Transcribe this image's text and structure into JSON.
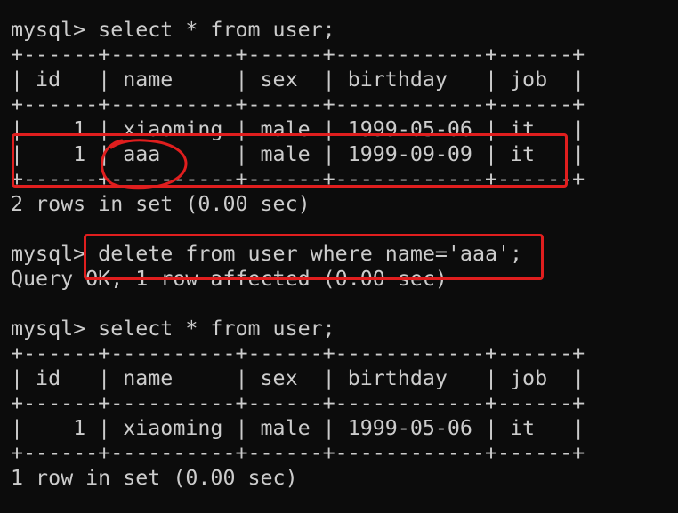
{
  "colors": {
    "background": "#0c0c0c",
    "text": "#cccccc",
    "annotation": "#e01e1e"
  },
  "terminal": {
    "lines": [
      "mysql> select * from user;",
      "+------+----------+------+------------+------+",
      "| id   | name     | sex  | birthday   | job  |",
      "+------+----------+------+------------+------+",
      "|    1 | xiaoming | male | 1999-05-06 | it   |",
      "|    1 | aaa      | male | 1999-09-09 | it   |",
      "+------+----------+------+------------+------+",
      "2 rows in set (0.00 sec)",
      "",
      "mysql> delete from user where name='aaa';",
      "Query OK, 1 row affected (0.00 sec)",
      "",
      "mysql> select * from user;",
      "+------+----------+------+------------+------+",
      "| id   | name     | sex  | birthday   | job  |",
      "+------+----------+------+------------+------+",
      "|    1 | xiaoming | male | 1999-05-06 | it   |",
      "+------+----------+------+------------+------+",
      "1 row in set (0.00 sec)"
    ]
  }
}
